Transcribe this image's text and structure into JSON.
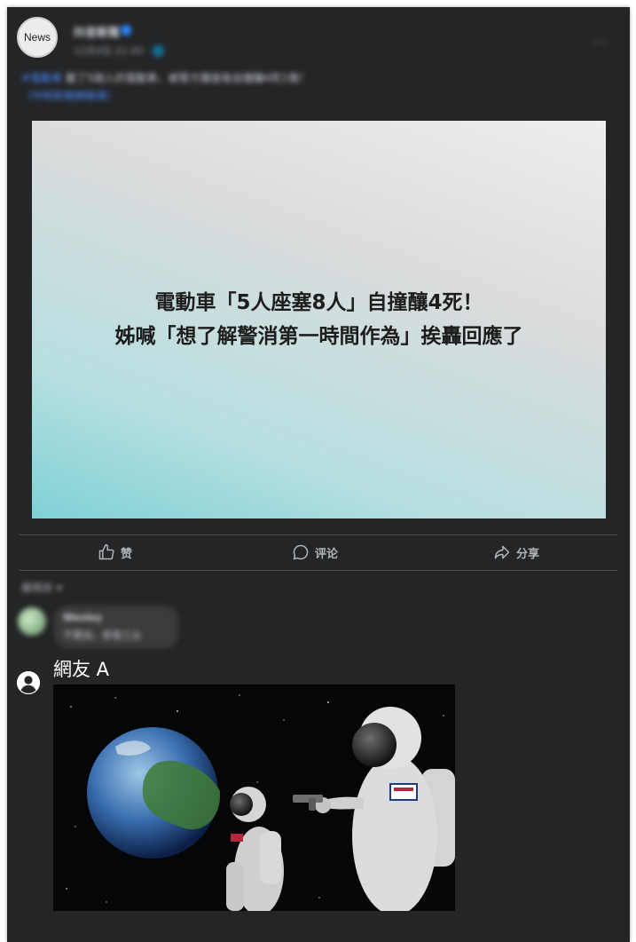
{
  "post": {
    "avatar_label": "News",
    "page_name": "抖音新聞",
    "time": "12月4日 21:40 · 🌐",
    "more": "···",
    "text_tag": "#電動車",
    "text": "載了5個人的電動車，被警方攔查後自撞釀4死1傷！",
    "text_line2": "〔中時新聞網報導〕"
  },
  "link_card": {
    "headline_line1": "電動車「5人座塞8人」自撞釀4死！",
    "headline_line2": "姊喊「想了解警消第一時間作為」挨轟回應了"
  },
  "actions": {
    "like": "赞",
    "comment": "评论",
    "share": "分享"
  },
  "comments": {
    "sort_label": "最相关 ▾",
    "first": {
      "name": "Wesley",
      "text": "不要說，是電工出"
    },
    "second": {
      "name": "網友 A",
      "image_desc_icon": "astronaut-meme-image"
    }
  }
}
